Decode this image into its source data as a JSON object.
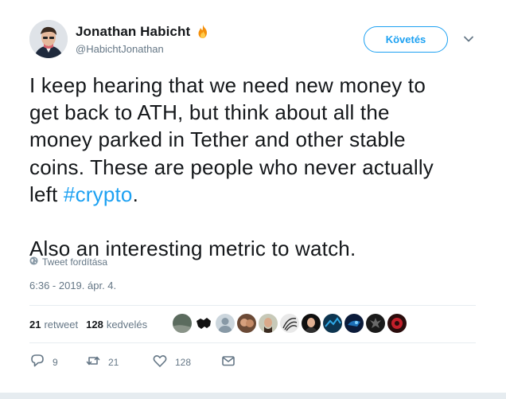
{
  "author": {
    "name": "Jonathan Habicht",
    "handle": "@HabichtJonathan",
    "emoji_icon": "fire-icon"
  },
  "follow_button": {
    "label": "Követés"
  },
  "tweet": {
    "text_before": "I keep hearing that we need new money to\nget back to ATH, but think about all the\nmoney parked in Tether and other stable\ncoins. These are people who never actually\nleft ",
    "hashtag": "#crypto",
    "text_after": ".\n\nAlso an interesting metric to watch."
  },
  "translate": {
    "label": "Tweet fordítása",
    "icon": "globe-icon"
  },
  "timestamp": "6:36 - 2019. ápr. 4.",
  "stats": {
    "retweets_count": "21",
    "retweets_label": "retweet",
    "likes_count": "128",
    "likes_label": "kedvelés"
  },
  "liker_avatars": [
    "avatar-1",
    "avatar-2",
    "avatar-3",
    "avatar-4",
    "avatar-5",
    "avatar-6",
    "avatar-7",
    "avatar-8",
    "avatar-9",
    "avatar-10",
    "avatar-11"
  ],
  "actions": {
    "reply_count": "9",
    "retweet_count": "21",
    "like_count": "128"
  },
  "colors": {
    "accent": "#1da1f2",
    "text": "#14171a",
    "secondary": "#657786",
    "fire": "#f4900c"
  }
}
